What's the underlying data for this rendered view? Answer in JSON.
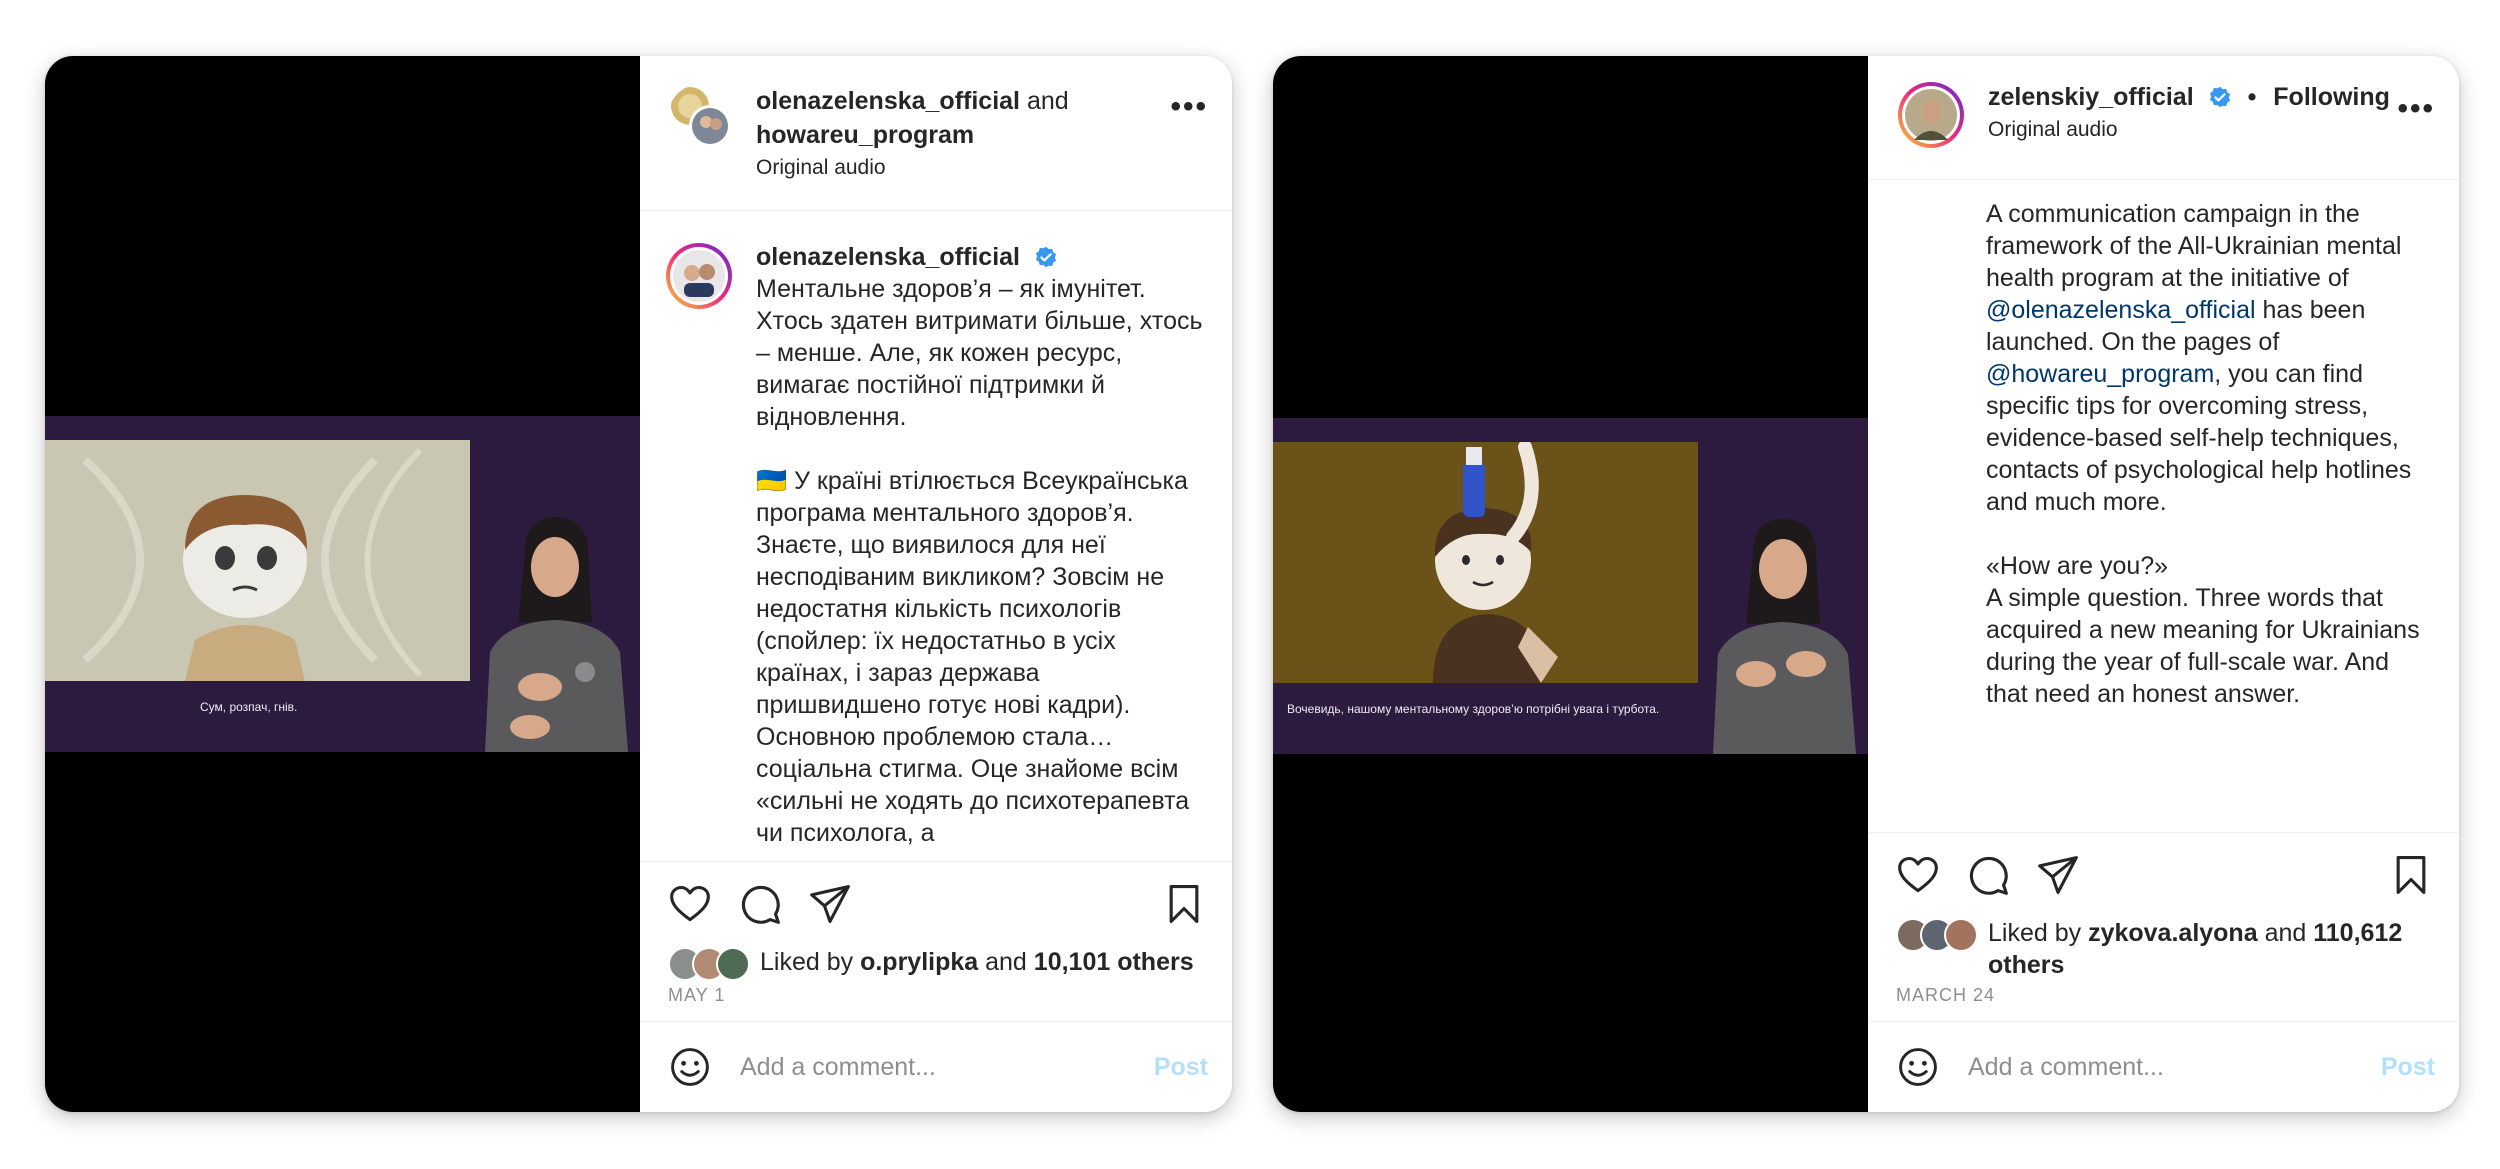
{
  "post1": {
    "header": {
      "username": "olenazelenska_official",
      "connector": "and",
      "collaborator": "howareu_program",
      "audio": "Original audio",
      "more_icon": "more-horizontal-icon"
    },
    "media": {
      "subtitle": "Сум, розпач, гнів."
    },
    "caption": {
      "username": "olenazelenska_official",
      "paragraphs": [
        "Ментальне здоров’я – як імунітет. Хтось здатен витримати більше, хтось – менше. Але, як кожен ресурс, вимагає постійної підтримки й відновлення.",
        "🇺🇦 У країні втілюється Всеукраїнська програма ментального здоров’я. Знаєте, що виявилося для неї несподіваним викликом? Зовсім не недостатня кількість психологів (спойлер: їх недостатньо в усіх країнах, і зараз держава пришвидшено готує нові кадри). Основною проблемою стала… соціальна стигма. Оце знайоме всім «сильні не ходять до психотерапевта чи психолога, а"
      ]
    },
    "likes": {
      "prefix": "Liked by",
      "user": "o.prylipka",
      "and": "and",
      "count": "10,101 others"
    },
    "date": "MAY 1",
    "comment": {
      "placeholder": "Add a comment...",
      "post_label": "Post"
    }
  },
  "post2": {
    "header": {
      "username": "zelenskiy_official",
      "separator": "•",
      "following": "Following",
      "audio": "Original audio",
      "more_icon": "more-horizontal-icon"
    },
    "media": {
      "subtitle": "Вочевидь, нашому ментальному здоров’ю потрібні увага і турбота."
    },
    "caption": {
      "p1_before": "A communication campaign in the framework of the All-Ukrainian mental health program at the initiative of ",
      "p1_mention1": "@olenazelenska_official",
      "p1_middle": " has been launched. On the pages of ",
      "p1_mention2": "@howareu_program",
      "p1_after": ", you can find specific tips for overcoming stress, evidence-based self-help techniques, contacts of psychological help hotlines and much more.",
      "p2_line1": "«How are you?»",
      "p2_rest": "A simple question. Three words that acquired a new meaning for Ukrainians during the year of full-scale war. And that need an honest answer."
    },
    "likes": {
      "prefix": "Liked by",
      "user": "zykova.alyona",
      "and": "and",
      "count": "110,612 others"
    },
    "date": "MARCH 24",
    "comment": {
      "placeholder": "Add a comment...",
      "post_label": "Post"
    }
  },
  "colors": {
    "verified": "#3897f0",
    "mention": "#00376b",
    "post_button": "#b2dffc",
    "video_band": "#2d1b3f"
  },
  "icons": [
    "heart-icon",
    "comment-icon",
    "share-icon",
    "bookmark-icon",
    "emoji-icon",
    "verified-badge-icon"
  ]
}
